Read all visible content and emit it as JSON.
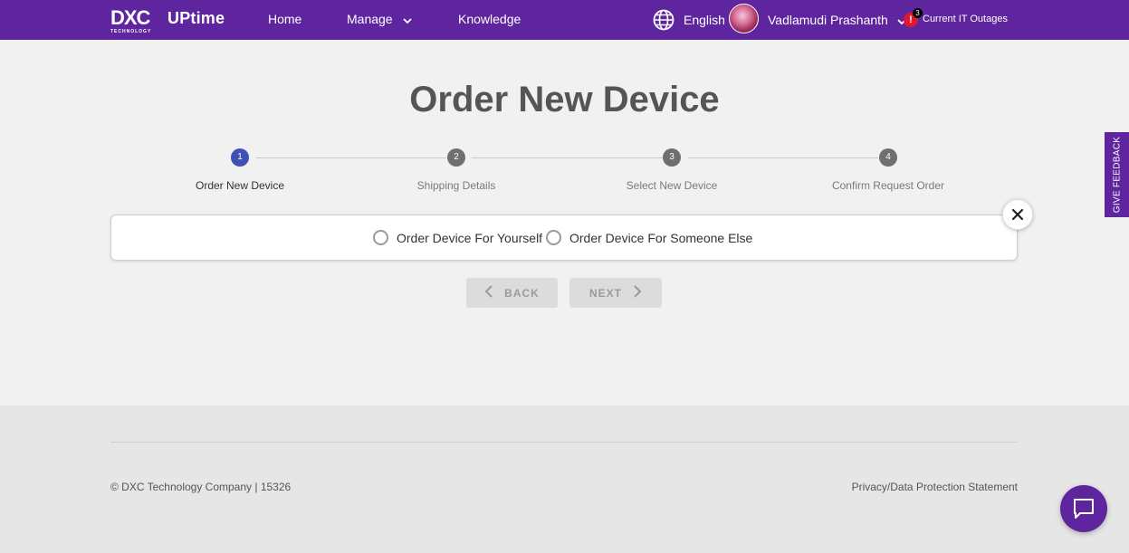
{
  "header": {
    "logo_text": "DXC",
    "logo_subtext": "TECHNOLOGY",
    "app_name": "UPtime",
    "nav": [
      {
        "label": "Home"
      },
      {
        "label": "Manage"
      },
      {
        "label": "Knowledge"
      }
    ],
    "language": "English",
    "user_name": "Vadlamudi Prashanth",
    "outages": {
      "count": "3",
      "icon": "!",
      "label": "Current IT Outages"
    },
    "brand_color": "#5f259f"
  },
  "page": {
    "title": "Order New Device"
  },
  "stepper": {
    "steps": [
      {
        "number": "1",
        "label": "Order New Device",
        "active": true
      },
      {
        "number": "2",
        "label": "Shipping Details",
        "active": false
      },
      {
        "number": "3",
        "label": "Select New Device",
        "active": false
      },
      {
        "number": "4",
        "label": "Confirm Request Order",
        "active": false
      }
    ],
    "active_color": "#3f51b5"
  },
  "options": {
    "items": [
      {
        "label": "Order Device For Yourself",
        "selected": false
      },
      {
        "label": "Order Device For Someone Else",
        "selected": false
      }
    ]
  },
  "actions": {
    "back_label": "BACK",
    "next_label": "NEXT"
  },
  "footer": {
    "copyright": "© DXC Technology Company | 15326",
    "privacy_link": "Privacy/Data Protection Statement"
  },
  "feedback_tab": "GIVE FEEDBACK"
}
